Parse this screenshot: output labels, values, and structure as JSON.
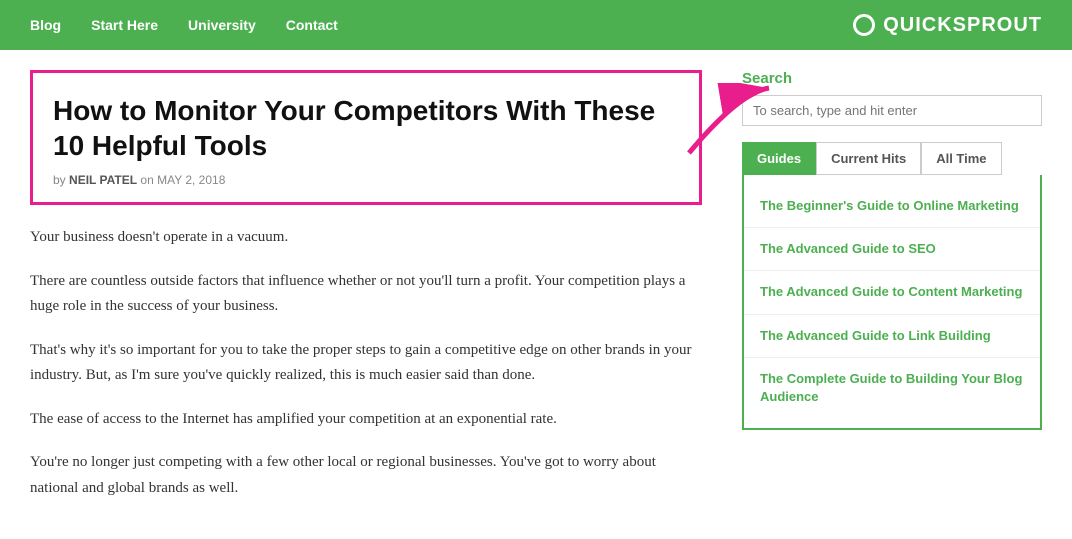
{
  "nav": {
    "links": [
      {
        "label": "Blog",
        "id": "blog"
      },
      {
        "label": "Start Here",
        "id": "start-here"
      },
      {
        "label": "University",
        "id": "university"
      },
      {
        "label": "Contact",
        "id": "contact"
      }
    ],
    "brand": "QUICKSPROUT"
  },
  "article": {
    "title": "How to Monitor Your Competitors With These 10 Helpful Tools",
    "meta_by": "by",
    "meta_author": "NEIL PATEL",
    "meta_on": "on",
    "meta_date": "MAY 2, 2018",
    "paragraphs": [
      "Your business doesn't operate in a vacuum.",
      "There are countless outside factors that influence whether or not you'll turn a profit. Your competition plays a huge role in the success of your business.",
      "That's why it's so important for you to take the proper steps to gain a competitive edge on other brands in your industry. But, as I'm sure you've quickly realized, this is much easier said than done.",
      "The ease of access to the Internet has amplified your competition at an exponential rate.",
      "You're no longer just competing with a few other local or regional businesses. You've got to worry about national and global brands as well."
    ]
  },
  "sidebar": {
    "search_label": "Search",
    "search_placeholder": "To search, type and hit enter",
    "tabs": [
      {
        "label": "Guides",
        "active": true
      },
      {
        "label": "Current Hits",
        "active": false
      },
      {
        "label": "All Time",
        "active": false
      }
    ],
    "guides": [
      {
        "label": "The Beginner's Guide to Online Marketing"
      },
      {
        "label": "The Advanced Guide to SEO"
      },
      {
        "label": "The Advanced Guide to Content Marketing"
      },
      {
        "label": "The Advanced Guide to Link Building"
      },
      {
        "label": "The Complete Guide to Building Your Blog Audience"
      }
    ]
  }
}
